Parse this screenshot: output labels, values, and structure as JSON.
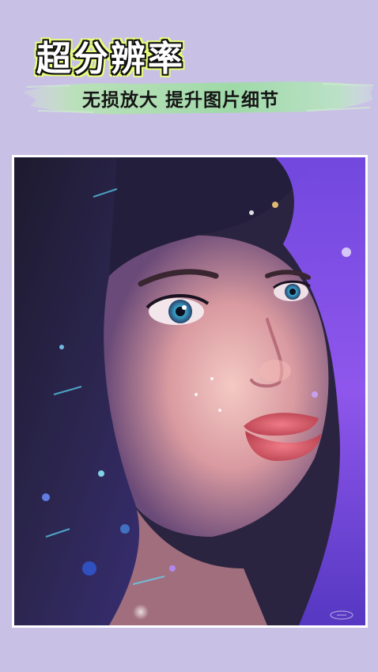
{
  "headline": "超分辨率",
  "subtitle": "无损放大 提升图片细节",
  "colors": {
    "background": "#c9c0e6",
    "headline_fill": "#ffffff",
    "headline_outline": "#111111",
    "headline_glow": "#e9ff7a",
    "brush_green": "#9fd9a8",
    "subtitle_text": "#151515"
  },
  "image": {
    "subject": "portrait-illustration"
  }
}
